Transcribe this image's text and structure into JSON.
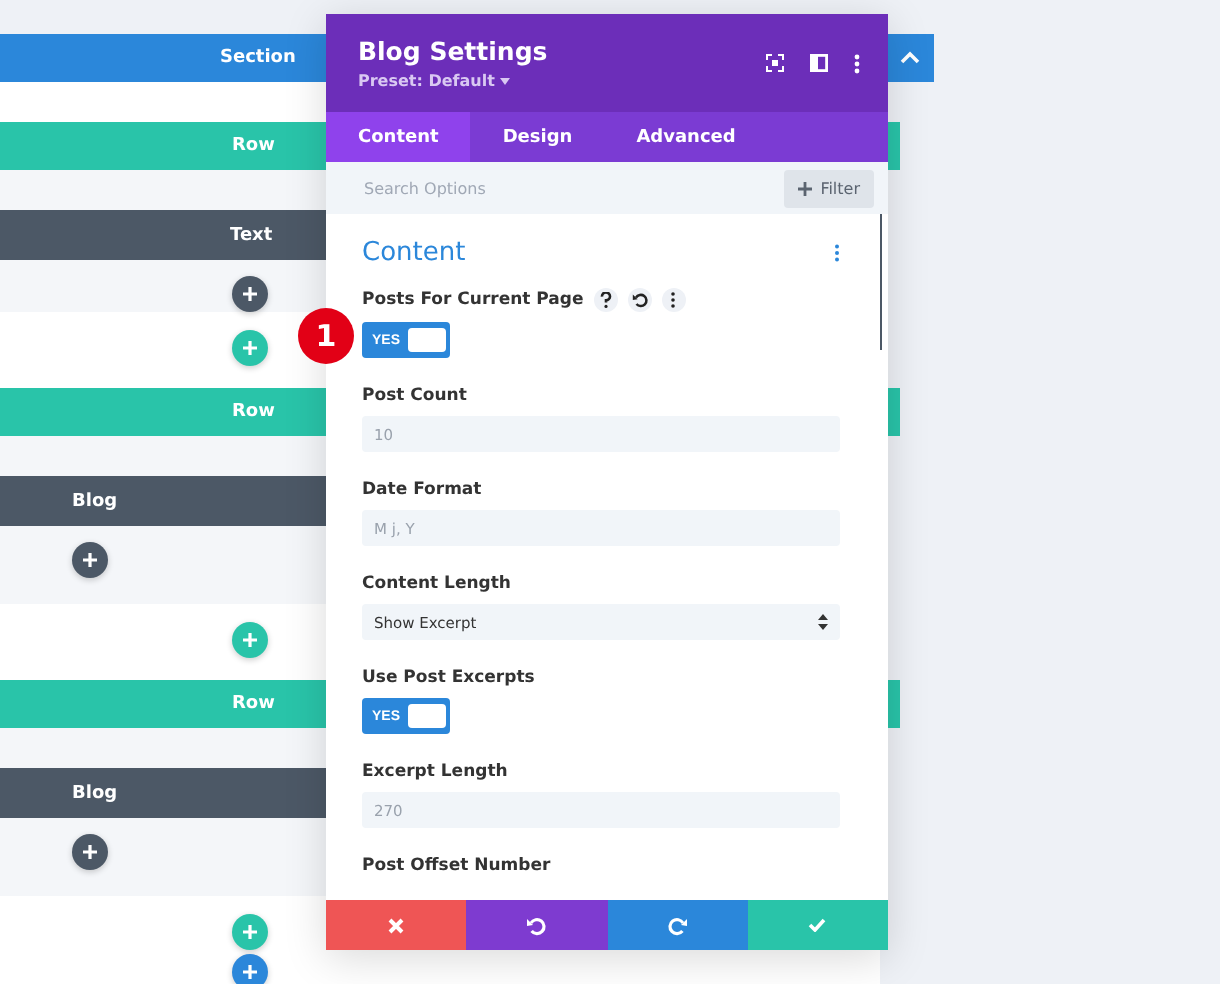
{
  "builder": {
    "section": {
      "label": "Section"
    },
    "rows": [
      {
        "label": "Row",
        "kind": "single",
        "modules": [
          {
            "label": "Text"
          }
        ]
      },
      {
        "label": "Row",
        "kind": "columns",
        "modules": [
          {
            "label": "Blog"
          }
        ]
      },
      {
        "label": "Row",
        "kind": "columns",
        "modules": [
          {
            "label": "Blog"
          }
        ]
      }
    ]
  },
  "badge": "1",
  "modal": {
    "title": "Blog Settings",
    "preset": "Preset: Default",
    "tabs": [
      {
        "label": "Content",
        "selected": true
      },
      {
        "label": "Design",
        "selected": false
      },
      {
        "label": "Advanced",
        "selected": false
      }
    ],
    "search": {
      "placeholder": "Search Options"
    },
    "filter": "Filter",
    "group": "Content",
    "fields": [
      {
        "kind": "toggle",
        "label": "Posts For Current Page",
        "on": true,
        "text": "YES",
        "tools": true
      },
      {
        "kind": "text",
        "label": "Post Count",
        "placeholder": "10"
      },
      {
        "kind": "text",
        "label": "Date Format",
        "placeholder": "M j, Y"
      },
      {
        "kind": "select",
        "label": "Content Length",
        "value": "Show Excerpt"
      },
      {
        "kind": "toggle",
        "label": "Use Post Excerpts",
        "on": true,
        "text": "YES",
        "tools": false
      },
      {
        "kind": "text",
        "label": "Excerpt Length",
        "placeholder": "270"
      },
      {
        "kind": "label",
        "label": "Post Offset Number"
      }
    ]
  }
}
